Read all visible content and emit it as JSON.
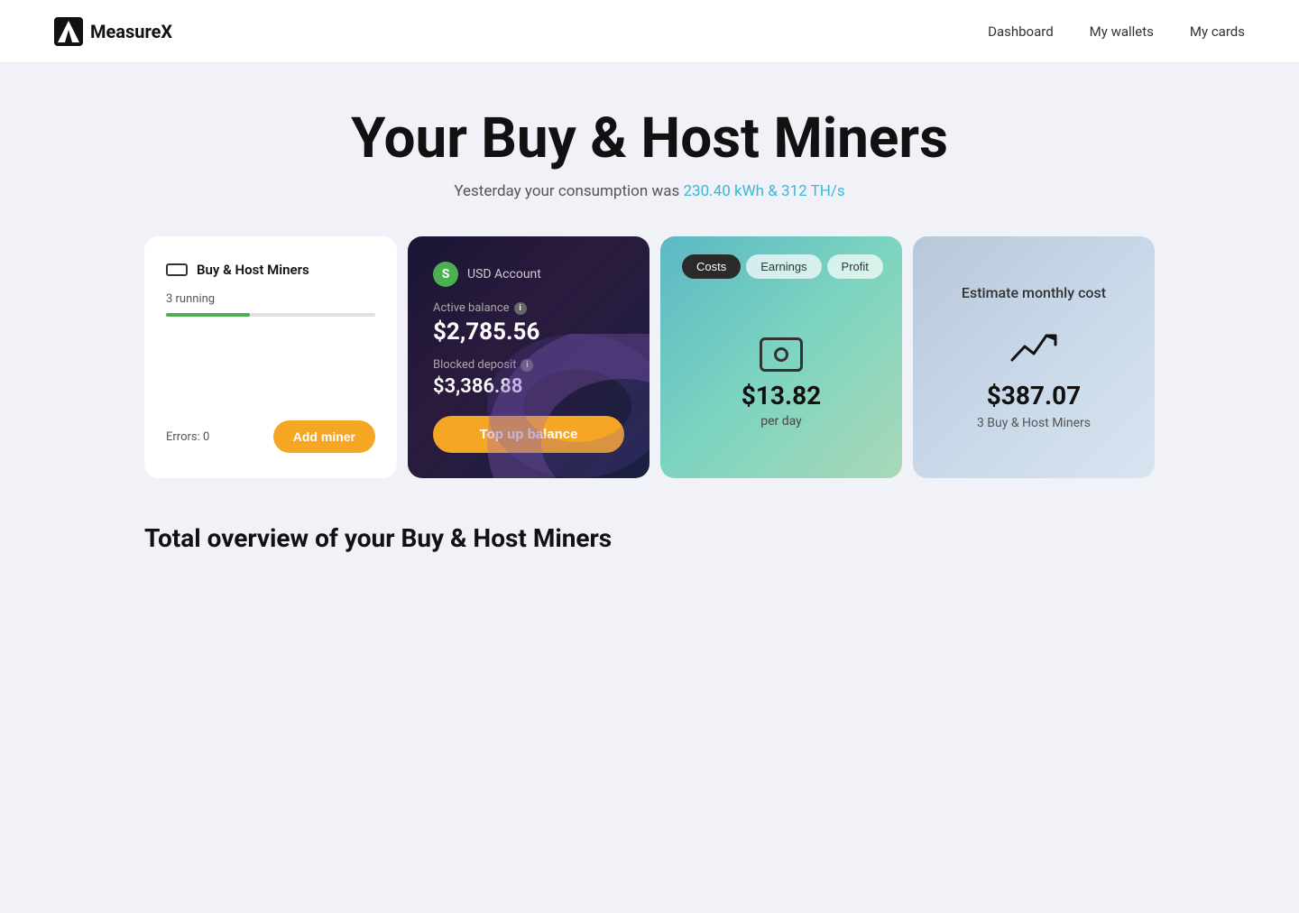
{
  "header": {
    "logo_text": "MeasureX",
    "nav_items": [
      "Dashboard",
      "My wallets",
      "My cards"
    ]
  },
  "hero": {
    "title": "Your Buy & Host Miners",
    "subtitle_prefix": "Yesterday your consumption was ",
    "subtitle_highlight": "230.40 kWh & 312 TH/s"
  },
  "card_miners": {
    "title": "Buy & Host Miners",
    "running_count": "3 running",
    "errors_label": "Errors: 0",
    "add_miner_button": "Add miner"
  },
  "card_usd": {
    "icon_letter": "S",
    "title": "USD Account",
    "active_balance_label": "Active balance",
    "active_balance_amount": "$2,785.56",
    "blocked_deposit_label": "Blocked deposit",
    "blocked_deposit_amount": "$3,386.88",
    "topup_button": "Top up balance"
  },
  "card_stats": {
    "tabs": [
      {
        "label": "Costs",
        "active": true
      },
      {
        "label": "Earnings",
        "active": false
      },
      {
        "label": "Profit",
        "active": false
      }
    ],
    "amount": "$13.82",
    "period": "per day"
  },
  "card_estimate": {
    "title": "Estimate monthly cost",
    "amount": "$387.07",
    "subtitle": "3 Buy & Host Miners"
  },
  "section": {
    "title": "Total overview of your Buy & Host Miners"
  }
}
